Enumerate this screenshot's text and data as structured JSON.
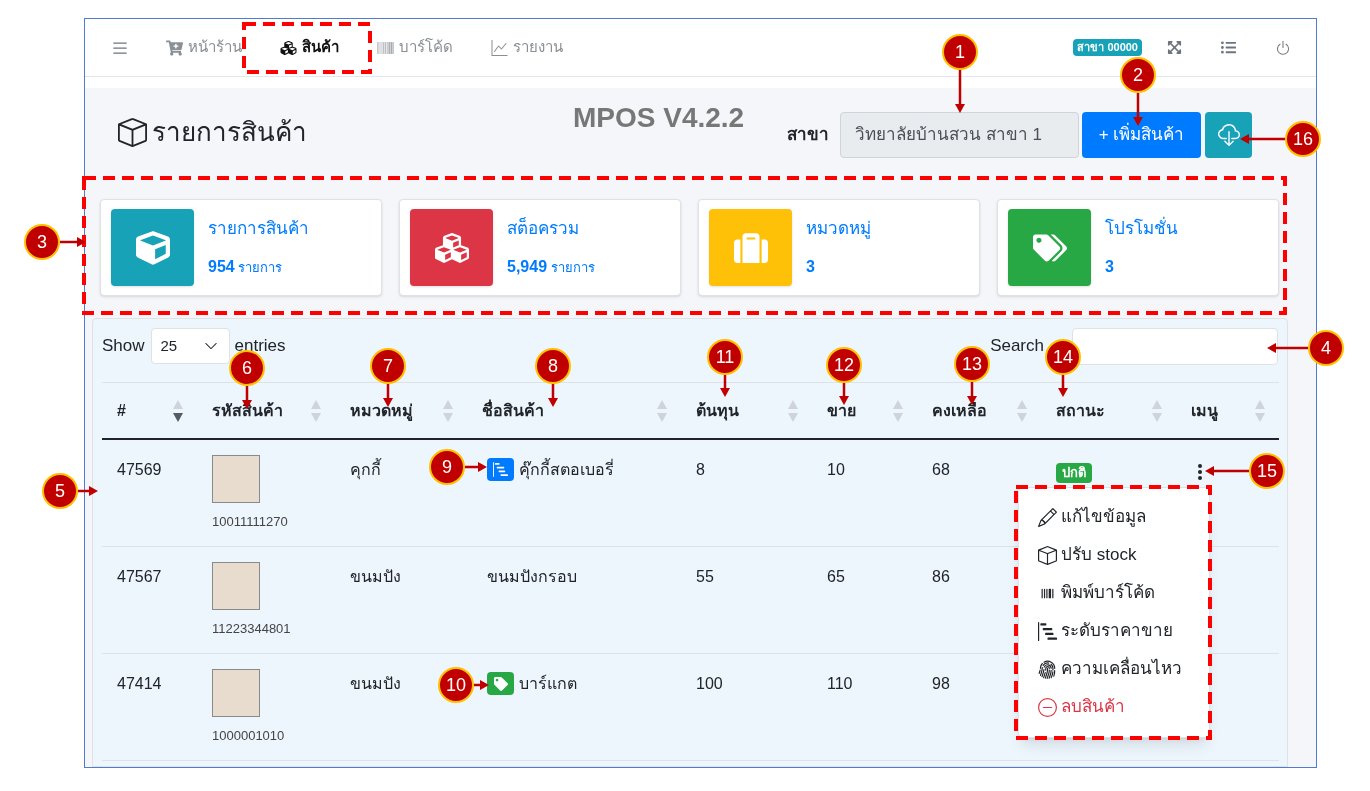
{
  "navbar": {
    "tabs": [
      {
        "label": "หน้าร้าน",
        "selected": false
      },
      {
        "label": "สินค้า",
        "selected": true
      },
      {
        "label": "บาร์โค้ด",
        "selected": false
      },
      {
        "label": "รายงาน",
        "selected": false
      }
    ],
    "branch_badge": "สาขา 00000"
  },
  "header": {
    "title": "รายการสินค้า",
    "version": "MPOS V4.2.2",
    "branch_label": "สาขา",
    "branch_value": "วิทยาลัยบ้านสวน สาขา 1",
    "add_button": "+ เพิ่มสินค้า"
  },
  "stat_cards": [
    {
      "title": "รายการสินค้า",
      "value": "954",
      "unit": "รายการ",
      "color": "#17a2b8"
    },
    {
      "title": "สต็อครวม",
      "value": "5,949",
      "unit": "รายการ",
      "color": "#dc3545"
    },
    {
      "title": "หมวดหมู่",
      "value": "3",
      "color": "#ffc107"
    },
    {
      "title": "โปรโมชั่น",
      "value": "3",
      "color": "#28a745"
    }
  ],
  "table": {
    "length_label": "Show",
    "page_length": "25",
    "length_suffix": "entries",
    "search_label": "Search",
    "columns": [
      {
        "label": "#",
        "sorted": true
      },
      {
        "label": "รหัสสินค้า",
        "sorted": false
      },
      {
        "label": "หมวดหมู่",
        "sorted": false
      },
      {
        "label": "ชื่อสินค้า",
        "sorted": false
      },
      {
        "label": "ต้นทุน",
        "sorted": false
      },
      {
        "label": "ขาย",
        "sorted": false
      },
      {
        "label": "คงเหลือ",
        "sorted": false
      },
      {
        "label": "สถานะ",
        "sorted": false
      },
      {
        "label": "เมนู",
        "sorted": false
      }
    ],
    "rows": [
      {
        "id": "47569",
        "barcode": "10011111270",
        "category": "คุกกี้",
        "name": "คุ๊กกี้สตอเบอรี่",
        "kind": "price_levels",
        "cost": "8",
        "price": "10",
        "stock": "68",
        "status": "ปกติ",
        "menu_button": true
      },
      {
        "id": "47567",
        "barcode": "11223344801",
        "category": "ขนมปัง",
        "name": "ขนมปังกรอบ",
        "kind": "plain",
        "cost": "55",
        "price": "65",
        "stock": "86"
      },
      {
        "id": "47414",
        "barcode": "1000001010",
        "category": "ขนมปัง",
        "name": "บาร์แกต",
        "kind": "promotion",
        "cost": "100",
        "price": "110",
        "stock": "98"
      }
    ]
  },
  "row_menu": {
    "items": [
      {
        "label": "แก้ไขข้อมูล",
        "kind": "edit"
      },
      {
        "label": "ปรับ stock",
        "kind": "adjust_stock"
      },
      {
        "label": "พิมพ์บาร์โค้ด",
        "kind": "print_barcode"
      },
      {
        "label": "ระดับราคาขาย",
        "kind": "price_levels"
      },
      {
        "label": "ความเคลื่อนไหว",
        "kind": "movement"
      },
      {
        "label": "ลบสินค้า",
        "kind": "delete"
      }
    ]
  },
  "callouts": [
    {
      "number": "1"
    },
    {
      "number": "2"
    },
    {
      "number": "3"
    },
    {
      "number": "4"
    },
    {
      "number": "5"
    },
    {
      "number": "6"
    },
    {
      "number": "7"
    },
    {
      "number": "8"
    },
    {
      "number": "9"
    },
    {
      "number": "10"
    },
    {
      "number": "11"
    },
    {
      "number": "12"
    },
    {
      "number": "13"
    },
    {
      "number": "14"
    },
    {
      "number": "15"
    },
    {
      "number": "16"
    }
  ]
}
